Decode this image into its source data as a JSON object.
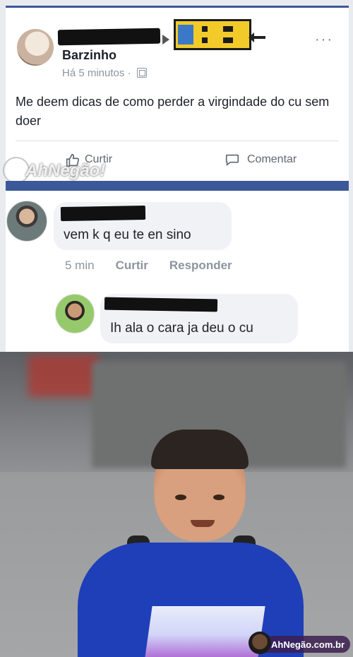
{
  "post": {
    "page_name": "Barzinho",
    "time": "Há 5 minutos",
    "dot": "·",
    "text": "Me deem dicas de como perder a virgindade do cu sem doer",
    "more": "···",
    "actions": {
      "like": "Curtir",
      "comment": "Comentar"
    }
  },
  "watermark": {
    "brand": "AhNegão!",
    "domain": ".com.br"
  },
  "comments": [
    {
      "text": "vem k q eu te en sino",
      "meta_time": "5 min",
      "meta_like": "Curtir",
      "meta_reply": "Responder"
    },
    {
      "text": "Ih ala o cara ja deu o cu"
    }
  ],
  "photo_watermark": "AhNegão.com.br",
  "colors": {
    "facebook_blue": "#3b5998",
    "bubble": "#f0f2f5",
    "meta_gray": "#8d949e"
  }
}
